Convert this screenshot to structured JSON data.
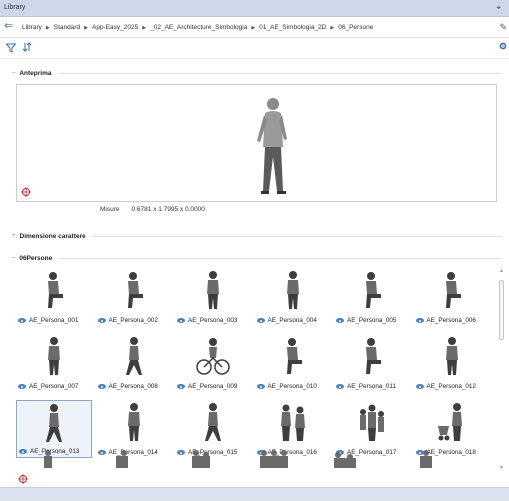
{
  "window": {
    "title": "Library",
    "pin_glyph": "ᵖ"
  },
  "breadcrumb": {
    "items": [
      "Library",
      "Standard",
      "App-Easy_2025",
      "_02_AE_Architecture_Simbologia",
      "01_AE_Simbologia_2D",
      "06_Persone"
    ],
    "separator": "▶"
  },
  "sections": {
    "preview": {
      "label": "Anteprima"
    },
    "font_size": {
      "label": "Dimensione carattere"
    },
    "group": {
      "label": "06Persone"
    }
  },
  "preview": {
    "measure_label": "Misure",
    "measure_value": "0.6781 x 1.7995 x 0.0000"
  },
  "items": [
    {
      "label": "AE_Persona_001"
    },
    {
      "label": "AE_Persona_002"
    },
    {
      "label": "AE_Persona_003"
    },
    {
      "label": "AE_Persona_004"
    },
    {
      "label": "AE_Persona_005"
    },
    {
      "label": "AE_Persona_006"
    },
    {
      "label": "AE_Persona_007"
    },
    {
      "label": "AE_Persona_008"
    },
    {
      "label": "AE_Persona_009"
    },
    {
      "label": "AE_Persona_010"
    },
    {
      "label": "AE_Persona_011"
    },
    {
      "label": "AE_Persona_012"
    },
    {
      "label": "AE_Persona_013"
    },
    {
      "label": "AE_Persona_014"
    },
    {
      "label": "AE_Persona_015"
    },
    {
      "label": "AE_Persona_016"
    },
    {
      "label": "AE_Persona_017"
    },
    {
      "label": "AE_Persona_018"
    }
  ],
  "selected_item": "AE_Persona_013",
  "colors": {
    "accent": "#3a6fb0",
    "titlebar": "#cdd9e8",
    "selection_border": "#8aa6c9"
  }
}
